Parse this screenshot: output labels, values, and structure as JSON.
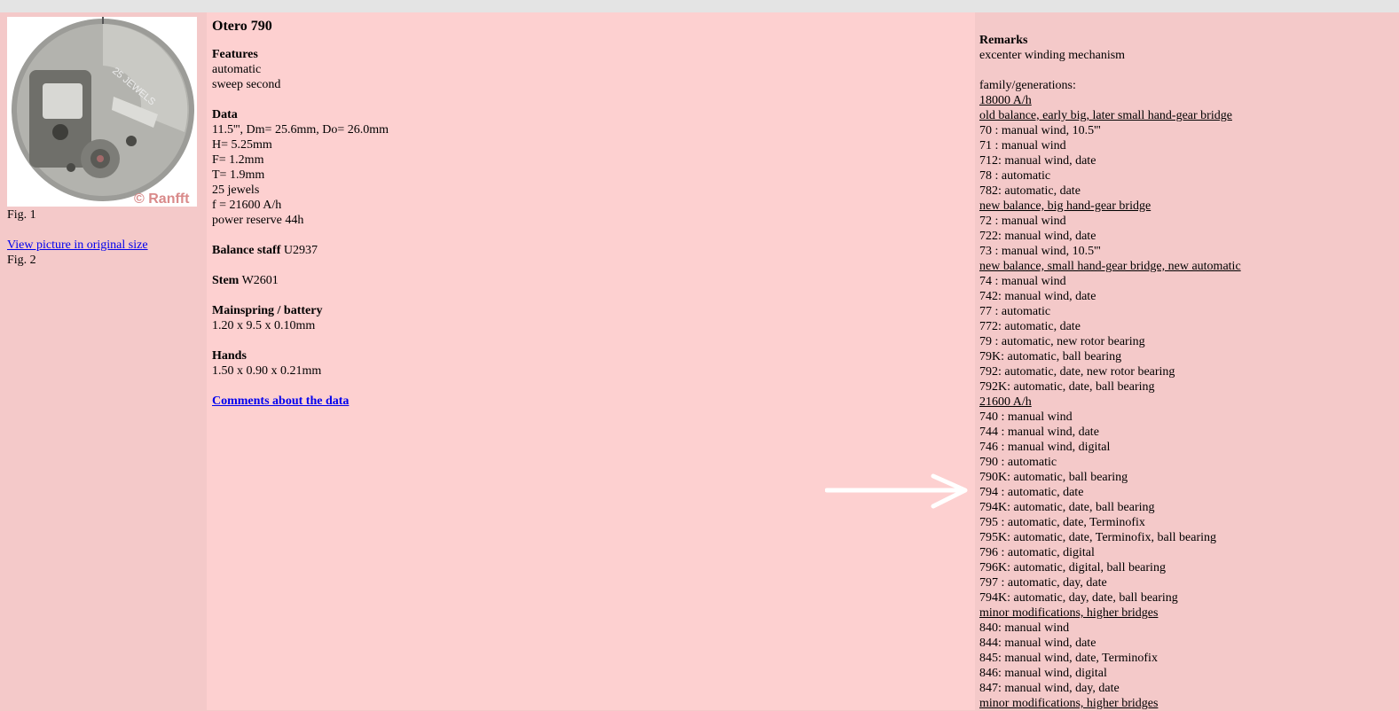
{
  "photo": {
    "dial_text": "25 JEWELS",
    "watermark": "© Ranfft"
  },
  "left": {
    "fig1": "Fig. 1",
    "view_link": "View picture in original size",
    "fig2": "Fig. 2"
  },
  "main": {
    "title": "Otero 790",
    "features_label": "Features",
    "features": [
      "automatic",
      "sweep second"
    ],
    "data_label": "Data",
    "data": [
      "11.5''', Dm= 25.6mm, Do= 26.0mm",
      "H= 5.25mm",
      "F= 1.2mm",
      "T= 1.9mm",
      "25 jewels",
      "f = 21600 A/h",
      "power reserve 44h"
    ],
    "balance_label": "Balance staff",
    "balance_value": " U2937",
    "stem_label": "Stem",
    "stem_value": " W2601",
    "mainspring_label": "Mainspring / battery",
    "mainspring_value": "1.20 x 9.5 x 0.10mm",
    "hands_label": "Hands",
    "hands_value": "1.50 x 0.90 x 0.21mm",
    "comments_link": "Comments about the data"
  },
  "remarks": {
    "label": "Remarks",
    "text": "excenter winding mechanism",
    "family_label": "family/generations:",
    "lines": [
      {
        "t": "18000 A/h",
        "u": true
      },
      {
        "t": "old balance, early big, later small hand-gear bridge",
        "u": true
      },
      {
        "t": "70 : manual wind, 10.5'''",
        "u": false
      },
      {
        "t": "71 : manual wind",
        "u": false
      },
      {
        "t": "712: manual wind, date",
        "u": false
      },
      {
        "t": "78 : automatic",
        "u": false
      },
      {
        "t": "782: automatic, date",
        "u": false
      },
      {
        "t": "new balance, big hand-gear bridge",
        "u": true
      },
      {
        "t": "72 : manual wind",
        "u": false
      },
      {
        "t": "722: manual wind, date",
        "u": false
      },
      {
        "t": "73 : manual wind, 10.5'''",
        "u": false
      },
      {
        "t": "new balance, small hand-gear bridge, new automatic",
        "u": true
      },
      {
        "t": "74 : manual wind",
        "u": false
      },
      {
        "t": "742: manual wind, date",
        "u": false
      },
      {
        "t": "77 : automatic",
        "u": false
      },
      {
        "t": "772: automatic, date",
        "u": false
      },
      {
        "t": "79 : automatic, new rotor bearing",
        "u": false
      },
      {
        "t": "79K: automatic, ball bearing",
        "u": false
      },
      {
        "t": "792: automatic, date, new rotor bearing",
        "u": false
      },
      {
        "t": "792K: automatic, date, ball bearing",
        "u": false
      },
      {
        "t": "21600 A/h",
        "u": true
      },
      {
        "t": "740 : manual wind",
        "u": false
      },
      {
        "t": "744 : manual wind, date",
        "u": false
      },
      {
        "t": "746 : manual wind, digital",
        "u": false
      },
      {
        "t": "790 : automatic",
        "u": false
      },
      {
        "t": "790K: automatic, ball bearing",
        "u": false
      },
      {
        "t": "794 : automatic, date",
        "u": false
      },
      {
        "t": "794K: automatic, date, ball bearing",
        "u": false
      },
      {
        "t": "795 : automatic, date, Terminofix",
        "u": false
      },
      {
        "t": "795K: automatic, date, Terminofix, ball bearing",
        "u": false
      },
      {
        "t": "796 : automatic, digital",
        "u": false
      },
      {
        "t": "796K: automatic, digital, ball bearing",
        "u": false
      },
      {
        "t": "797 : automatic, day, date",
        "u": false
      },
      {
        "t": "794K: automatic, day, date, ball bearing",
        "u": false
      },
      {
        "t": "minor modifications, higher bridges",
        "u": true
      },
      {
        "t": "840: manual wind",
        "u": false
      },
      {
        "t": "844: manual wind, date",
        "u": false
      },
      {
        "t": "845: manual wind, date, Terminofix",
        "u": false
      },
      {
        "t": "846: manual wind, digital",
        "u": false
      },
      {
        "t": "847: manual wind, day, date",
        "u": false
      },
      {
        "t": "minor modifications, higher bridges",
        "u": true
      }
    ]
  },
  "colors": {
    "left_bg": "#f4c9c9",
    "mid_bg": "#fdd0d0",
    "right_bg": "#f4c9c9",
    "link": "#0000ee",
    "topbar": "#e4e4e4"
  }
}
